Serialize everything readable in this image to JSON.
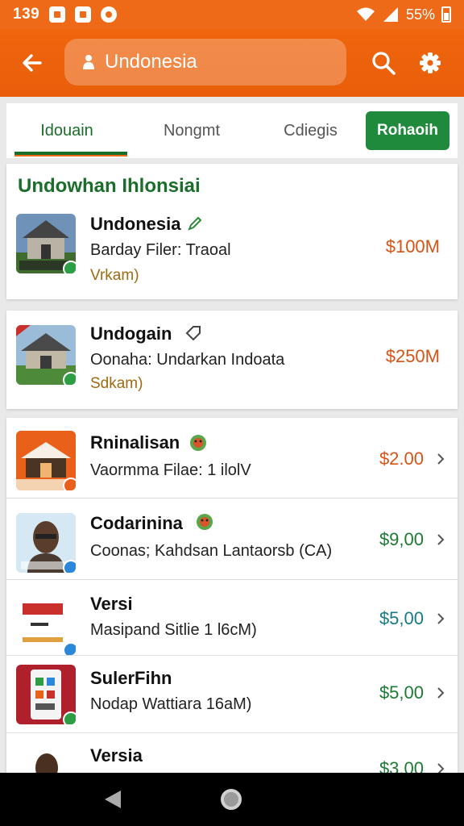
{
  "status_bar": {
    "time": "139",
    "battery_text": "55%",
    "icons": [
      "notification-icon",
      "message-icon",
      "app-icon",
      "wifi-icon",
      "signal-icon",
      "battery-icon"
    ]
  },
  "header": {
    "search": {
      "value": "Undonesia",
      "placeholder": "Undonesia"
    },
    "icons": [
      "back-arrow-icon",
      "location-pin-icon",
      "search-icon",
      "gear-icon"
    ]
  },
  "tabs": {
    "items": [
      {
        "label": "Idouain",
        "active": true
      },
      {
        "label": "Nongmt",
        "active": false
      },
      {
        "label": "Cdiegis",
        "active": false
      }
    ],
    "action_label": "Rohaoih"
  },
  "featured": {
    "section_title": "Undowhan Ihlonsiai",
    "items": [
      {
        "name": "Undonesia",
        "subtitle": "Barday Filer: Traoal",
        "note": "Vrkam)",
        "price": "$100M",
        "name_icon": "pencil-icon",
        "thumb_icon": "temple-icon"
      },
      {
        "name": "Undogain",
        "subtitle": "Oonaha: Undarkan Indoata",
        "note": "Sdkam)",
        "price": "$250M",
        "name_icon": "tag-icon",
        "thumb_icon": "temple-icon"
      }
    ]
  },
  "list": {
    "items": [
      {
        "name": "Rninalisan",
        "subtitle": "Vaormma Filae: 1 ilolV",
        "price": "$2.00",
        "price_color": "orange",
        "name_icon": "emoji-icon",
        "thumb_icon": "building-icon"
      },
      {
        "name": "Codarinina",
        "subtitle": "Coonas; Kahdsan Lantaorsb (CA)",
        "price": "$9,00",
        "price_color": "green",
        "name_icon": "emoji-icon",
        "thumb_icon": "person-icon"
      },
      {
        "name": "Versi",
        "subtitle": "Masipand Sitlie 1 l6cM)",
        "price": "$5,00",
        "price_color": "teal",
        "name_icon": "",
        "thumb_icon": "ticket-icon"
      },
      {
        "name": "SulerFihn",
        "subtitle": "Nodap Wattiara 16aM)",
        "price": "$5,00",
        "price_color": "green",
        "name_icon": "",
        "thumb_icon": "phone-app-icon"
      },
      {
        "name": "Versia",
        "subtitle": "",
        "price": "$3.00",
        "price_color": "green",
        "name_icon": "",
        "thumb_icon": "person-icon"
      }
    ]
  },
  "colors": {
    "brand_orange": "#ef6a18",
    "accent_green": "#1f8a3c",
    "price_orange": "#d45418",
    "price_green": "#1d7a33",
    "price_teal": "#177a86"
  }
}
